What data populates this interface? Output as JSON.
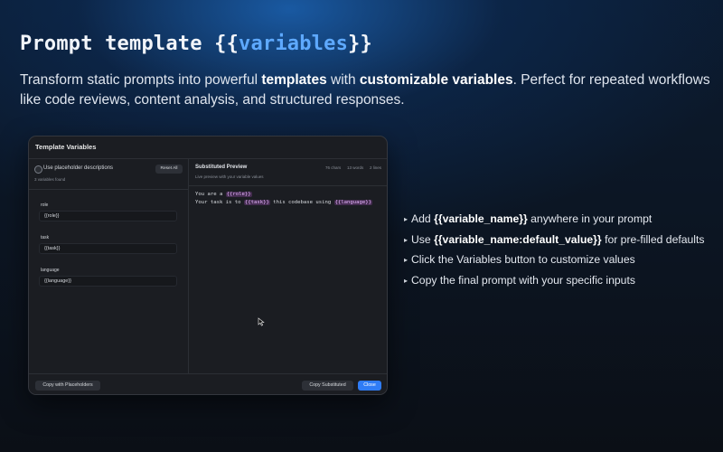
{
  "hero": {
    "title_prefix": "Prompt template {{",
    "title_var": "variables",
    "title_suffix": "}}",
    "desc_1": "Transform static prompts into powerful ",
    "desc_bold_1": "templates",
    "desc_2": " with ",
    "desc_bold_2": "customizable variables",
    "desc_3": ". Perfect for repeated workflows like code reviews, content analysis, and structured responses."
  },
  "window": {
    "title": "Template Variables",
    "left": {
      "checkbox_label": "Use placeholder descriptions",
      "vars_found": "3 variables found",
      "reset_label": "Reset All",
      "fields": [
        {
          "label": "role",
          "value": "{{role}}"
        },
        {
          "label": "task",
          "value": "{{task}}"
        },
        {
          "label": "language",
          "value": "{{language}}"
        }
      ]
    },
    "preview": {
      "title": "Substituted Preview",
      "subtitle": "Live preview with your variable values",
      "chars": "76 chars",
      "words": "13 words",
      "lines": "2 lines",
      "line1_text": "You are a ",
      "line1_tok": "{{role}}",
      "line2_a": "Your task is to ",
      "line2_tok1": "{{task}}",
      "line2_b": " this codebase using ",
      "line2_tok2": "{{language}}"
    },
    "footer": {
      "copy_placeholders": "Copy with Placeholders",
      "copy_substituted": "Copy Substituted",
      "close": "Close"
    }
  },
  "bullets": [
    {
      "a": "Add ",
      "b": "{{variable_name}}",
      "c": " anywhere in your prompt"
    },
    {
      "a": "Use ",
      "b": "{{variable_name:default_value}}",
      "c": " for pre-filled defaults"
    },
    {
      "a": "Click the Variables button to customize values",
      "b": "",
      "c": ""
    },
    {
      "a": "Copy the final prompt with your specific inputs",
      "b": "",
      "c": ""
    }
  ],
  "icons": {
    "bullet": "triangle-right-icon",
    "cursor": "mouse-pointer-icon"
  },
  "colors": {
    "accent": "#5ea9ff",
    "primary_button": "#2f7cf6",
    "token": "#e7b5ff"
  }
}
